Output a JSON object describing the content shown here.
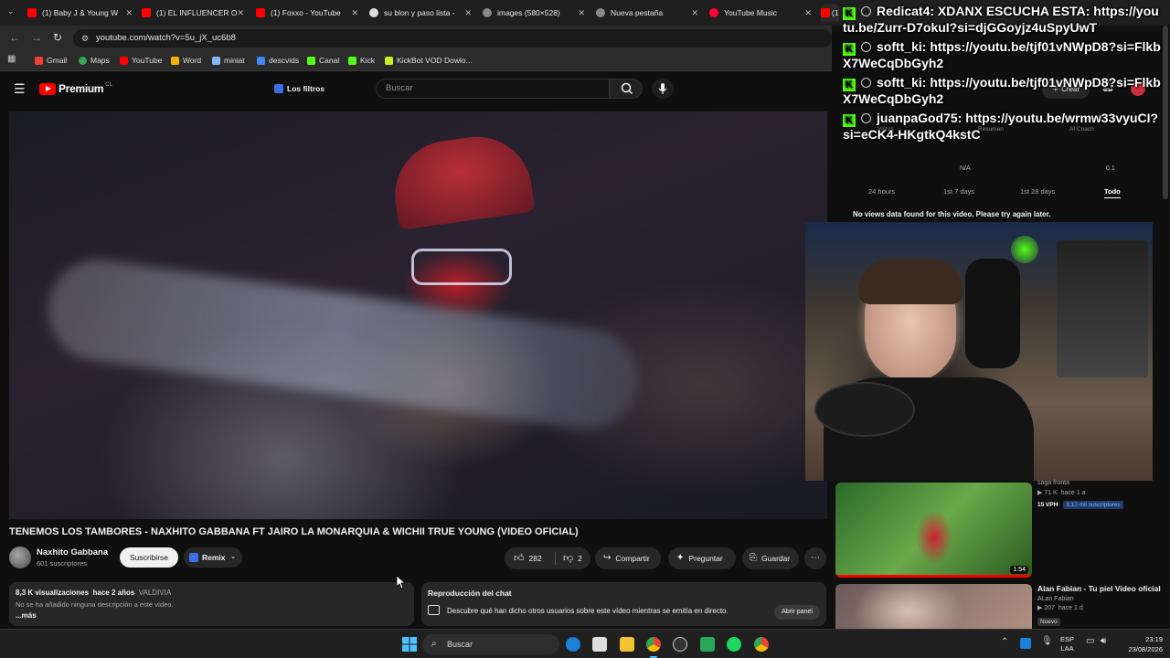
{
  "browser": {
    "tabs": [
      {
        "label": "(1) Baby J & Young W",
        "color": "#ff0000"
      },
      {
        "label": "(1) EL INFLUENCER O",
        "color": "#ff0000"
      },
      {
        "label": "(1) Foxxo - YouTube",
        "color": "#ff0000"
      },
      {
        "label": "su blon y paso lista -",
        "color": "#dddddd"
      },
      {
        "label": "images (580×528)",
        "color": "#aaaaaa"
      },
      {
        "label": "Nueva pestaña",
        "color": "#aaaaaa"
      },
      {
        "label": "YouTube Music",
        "color": "#ff0033"
      },
      {
        "label": "(1",
        "color": "#ff0000"
      }
    ],
    "url": "youtube.com/watch?v=5u_jX_uc6b8",
    "bookmarks": [
      {
        "label": "Gmail",
        "color": "#ea4335"
      },
      {
        "label": "Maps",
        "color": "#34a853"
      },
      {
        "label": "YouTube",
        "color": "#ff0000"
      },
      {
        "label": "Word",
        "color": "#f4b400"
      },
      {
        "label": "miniat",
        "color": "#8ab4f8"
      },
      {
        "label": "descvids",
        "color": "#4285f4"
      },
      {
        "label": "Canal",
        "color": "#53fc18"
      },
      {
        "label": "Kick",
        "color": "#53fc18"
      },
      {
        "label": "KickBot VOD Dowlo...",
        "color": "#c8f020"
      }
    ]
  },
  "youtube": {
    "logo": "Premium",
    "logo_region": "CL",
    "filters_label": "Los filtros",
    "search_placeholder": "Buscar",
    "video_title": "TENEMOS LOS TAMBORES - NAXHITO GABBANA FT JAIRO LA MONARQUIA & WICHII TRUE YOUNG (VIDEO OFICIAL)",
    "channel": {
      "name": "Naxhito Gabbana",
      "subs": "601 suscriptores"
    },
    "subscribe_label": "Suscribirse",
    "remix_label": "Remix",
    "likes": "282",
    "dislikes": "2",
    "share_label": "Compartir",
    "ask_label": "Preguntar",
    "save_label": "Guardar",
    "description": {
      "views": "8,3 K visualizaciones",
      "age": "hace 2 años",
      "location": "VALDIVIA",
      "text": "No se ha añadido ninguna descripción a este vídeo.",
      "more": "...más"
    },
    "chat_replay": {
      "title": "Reproducción del chat",
      "text": "Descubre qué han dicho otros usuarios sobre este vídeo mientras se emitía en directo.",
      "button": "Abrir panel"
    },
    "create_label": "Crear",
    "recommendations": [
      {
        "channel": "saga fronta",
        "views": "71 K",
        "age": "hace 1 a",
        "vph": "15 VPH",
        "subs": "3,12 mil suscriptores",
        "duration": "1:54"
      },
      {
        "title": "Alan Fabian - Tu piel Video oficial",
        "channel": "ALan Fabian",
        "views": "207",
        "age": "hace 1 d",
        "badge": "Nuevo"
      }
    ]
  },
  "stats_panel": {
    "tabs": [
      "24 hours",
      "1st 7 days",
      "1st 28 days",
      "Todo"
    ],
    "active_tab": "Todo",
    "message": "No views data found for this video. Please try again later.",
    "header_tabs": [
      "Vistas",
      "Resumen",
      "AI Coach"
    ],
    "metrics": [
      "N/A",
      "0.1"
    ]
  },
  "stream_chat": [
    {
      "user": "Redicat4:",
      "text": "XDANX ESCUCHA ESTA: https://youtu.be/Zurr-D7okuI?si=djGGoyjz4uSpyUwT"
    },
    {
      "user": "softt_ki:",
      "text": "https://youtu.be/tjf01vNWpD8?si=FlkbX7WeCqDbGyh2"
    },
    {
      "user": "softt_ki:",
      "text": "https://youtu.be/tjf01vNWpD8?si=FlkbX7WeCqDbGyh2"
    },
    {
      "user": "juanpaGod75:",
      "text": "https://youtu.be/wrmw33vyuCI?si=eCK4-HKgtkQ4kstC"
    }
  ],
  "taskbar": {
    "search_placeholder": "Buscar",
    "lang": "ESP",
    "lang_sub": "LAA",
    "time": "23:19",
    "date": "23/08/2026"
  }
}
